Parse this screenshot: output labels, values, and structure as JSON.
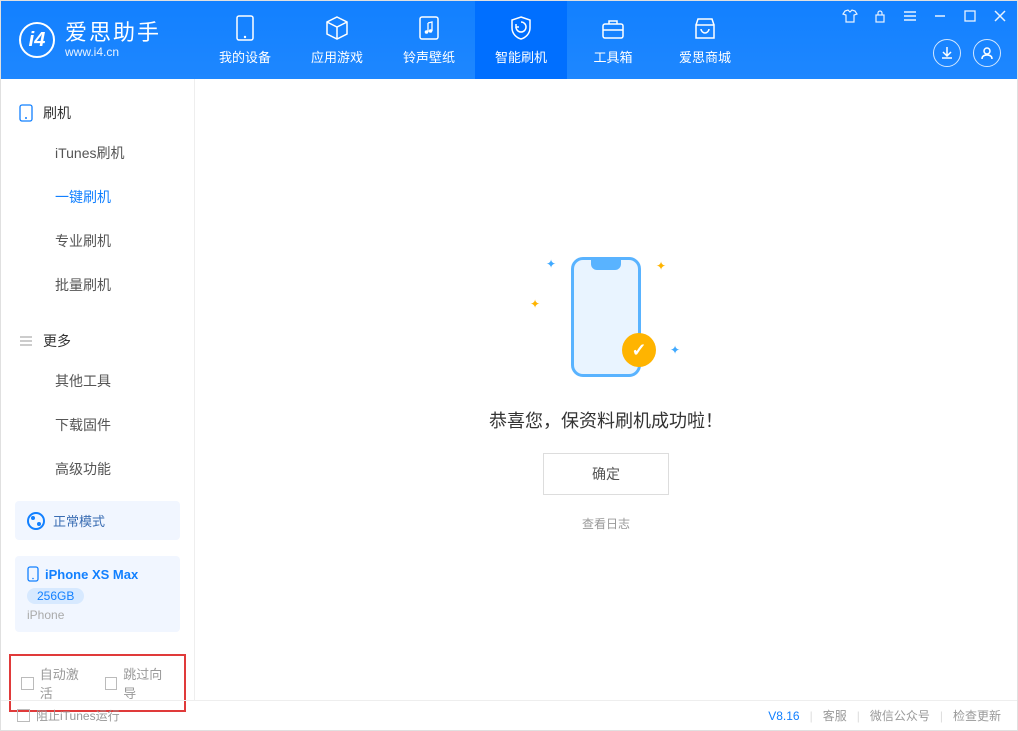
{
  "header": {
    "app_name": "爱思助手",
    "app_url": "www.i4.cn",
    "tabs": [
      {
        "label": "我的设备"
      },
      {
        "label": "应用游戏"
      },
      {
        "label": "铃声壁纸"
      },
      {
        "label": "智能刷机"
      },
      {
        "label": "工具箱"
      },
      {
        "label": "爱思商城"
      }
    ]
  },
  "sidebar": {
    "section1_title": "刷机",
    "section1_items": [
      "iTunes刷机",
      "一键刷机",
      "专业刷机",
      "批量刷机"
    ],
    "section2_title": "更多",
    "section2_items": [
      "其他工具",
      "下载固件",
      "高级功能"
    ],
    "mode_label": "正常模式",
    "device": {
      "name": "iPhone XS Max",
      "capacity": "256GB",
      "type": "iPhone"
    },
    "checkbox1": "自动激活",
    "checkbox2": "跳过向导"
  },
  "content": {
    "message": "恭喜您，保资料刷机成功啦！",
    "ok_button": "确定",
    "log_link": "查看日志"
  },
  "statusbar": {
    "stop_itunes": "阻止iTunes运行",
    "version": "V8.16",
    "links": [
      "客服",
      "微信公众号",
      "检查更新"
    ]
  }
}
